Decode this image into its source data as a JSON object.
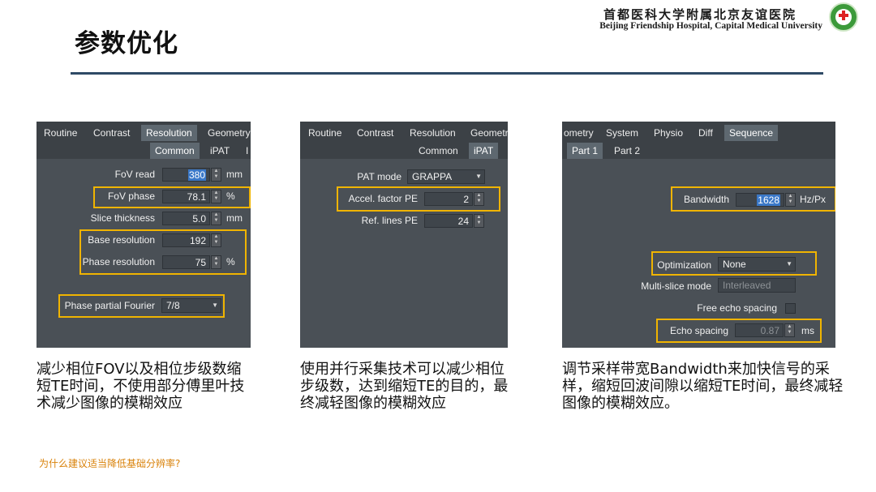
{
  "slide": {
    "title": "参数优化",
    "hospital_cn": "首都医科大学附属北京友谊医院",
    "hospital_en": "Beijing Friendship Hospital, Capital Medical University",
    "footnote": "为什么建议适当降低基础分辨率?"
  },
  "panel1": {
    "tabs": [
      "Routine",
      "Contrast",
      "Resolution",
      "Geometry"
    ],
    "subtabs": [
      "Common",
      "iPAT",
      "I"
    ],
    "fov_read_label": "FoV read",
    "fov_read_value": "380",
    "fov_read_unit": "mm",
    "fov_phase_label": "FoV phase",
    "fov_phase_value": "78.1",
    "fov_phase_unit": "%",
    "slice_label": "Slice thickness",
    "slice_value": "5.0",
    "slice_unit": "mm",
    "base_res_label": "Base resolution",
    "base_res_value": "192",
    "phase_res_label": "Phase resolution",
    "phase_res_value": "75",
    "phase_res_unit": "%",
    "ppf_label": "Phase partial Fourier",
    "ppf_value": "7/8"
  },
  "panel2": {
    "tabs": [
      "Routine",
      "Contrast",
      "Resolution",
      "Geometr"
    ],
    "subtabs": [
      "Common",
      "iPAT"
    ],
    "pat_mode_label": "PAT mode",
    "pat_mode_value": "GRAPPA",
    "accel_label": "Accel. factor PE",
    "accel_value": "2",
    "ref_label": "Ref. lines PE",
    "ref_value": "24"
  },
  "panel3": {
    "tabs": [
      "ometry",
      "System",
      "Physio",
      "Diff",
      "Sequence"
    ],
    "subtabs": [
      "Part 1",
      "Part 2"
    ],
    "bw_label": "Bandwidth",
    "bw_value": "1628",
    "bw_unit": "Hz/Px",
    "opt_label": "Optimization",
    "opt_value": "None",
    "msm_label": "Multi-slice mode",
    "msm_value": "Interleaved",
    "fes_label": "Free echo spacing",
    "es_label": "Echo spacing",
    "es_value": "0.87",
    "es_unit": "ms"
  },
  "captions": {
    "c1": "减少相位FOV以及相位步级数缩短TE时间，不使用部分傅里叶技术减少图像的模糊效应",
    "c2": "使用并行采集技术可以减少相位步级数，达到缩短TE的目的，最终减轻图像的模糊效应",
    "c3": "调节采样带宽Bandwidth来加快信号的采样，缩短回波间隙以缩短TE时间，最终减轻图像的模糊效应。"
  },
  "colors": {
    "highlight_box": "#f0b400",
    "title_rule": "#2f4a66",
    "footnote": "#d9820a"
  }
}
